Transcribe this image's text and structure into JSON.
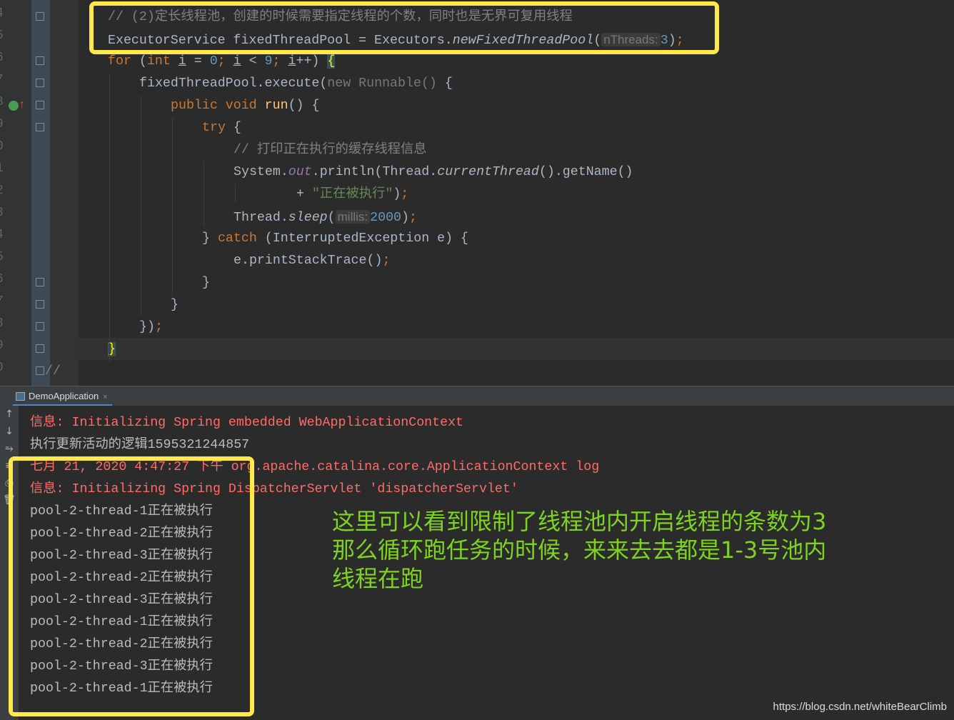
{
  "editor": {
    "line_numbers": [
      "4",
      "5",
      "6",
      "7",
      "8",
      "9",
      "0",
      "1",
      "2",
      "3",
      "4",
      "5",
      "6",
      "7",
      "8",
      "9",
      "0"
    ],
    "lines": [
      {
        "indent": 0,
        "tokens": [
          [
            "// (2)定长线程池，创建的时候需要指定线程的个数，同时也是无界可复用线程",
            "c"
          ]
        ]
      },
      {
        "indent": 0,
        "tokens": [
          [
            "ExecutorService fixedThreadPool = Executors.",
            ""
          ],
          [
            "newFixedThreadPool",
            "i"
          ],
          [
            "(",
            ""
          ],
          [
            "nThreads:",
            "h"
          ],
          [
            "3",
            "n"
          ],
          [
            ")",
            ""
          ],
          [
            ";",
            "k"
          ]
        ]
      },
      {
        "indent": 0,
        "tokens": [
          [
            "for",
            "k"
          ],
          [
            " (",
            ""
          ],
          [
            "int",
            "k"
          ],
          [
            " ",
            ""
          ],
          [
            "i",
            "u"
          ],
          [
            " = ",
            ""
          ],
          [
            "0",
            "n"
          ],
          [
            ";",
            "k"
          ],
          [
            " ",
            ""
          ],
          [
            "i",
            "u"
          ],
          [
            " < ",
            ""
          ],
          [
            "9",
            "n"
          ],
          [
            ";",
            "k"
          ],
          [
            " ",
            ""
          ],
          [
            "i",
            "u"
          ],
          [
            "++) ",
            ""
          ],
          [
            "{",
            "b"
          ]
        ]
      },
      {
        "indent": 1,
        "tokens": [
          [
            "fixedThreadPool.execute(",
            ""
          ],
          [
            "new Runnable()",
            "g"
          ],
          [
            " {",
            ""
          ]
        ]
      },
      {
        "indent": 2,
        "tokens": [
          [
            "public void ",
            "k"
          ],
          [
            "run",
            "fn"
          ],
          [
            "() {",
            ""
          ]
        ]
      },
      {
        "indent": 3,
        "tokens": [
          [
            "try",
            "k"
          ],
          [
            " {",
            ""
          ]
        ]
      },
      {
        "indent": 4,
        "tokens": [
          [
            "// 打印正在执行的缓存线程信息",
            "c"
          ]
        ]
      },
      {
        "indent": 4,
        "tokens": [
          [
            "System.",
            ""
          ],
          [
            "out",
            "f"
          ],
          [
            ".println(Thread.",
            ""
          ],
          [
            "currentThread",
            "i"
          ],
          [
            "().getName()",
            ""
          ]
        ]
      },
      {
        "indent": 6,
        "tokens": [
          [
            "+ ",
            ""
          ],
          [
            "\"正在被执行\"",
            "s"
          ],
          [
            ")",
            ""
          ],
          [
            ";",
            "k"
          ]
        ]
      },
      {
        "indent": 4,
        "tokens": [
          [
            "Thread.",
            ""
          ],
          [
            "sleep",
            "i"
          ],
          [
            "(",
            ""
          ],
          [
            "millis:",
            "h"
          ],
          [
            "2000",
            "n"
          ],
          [
            ")",
            ""
          ],
          [
            ";",
            "k"
          ]
        ]
      },
      {
        "indent": 3,
        "tokens": [
          [
            "} ",
            ""
          ],
          [
            "catch",
            "k"
          ],
          [
            " (InterruptedException e) {",
            ""
          ]
        ]
      },
      {
        "indent": 4,
        "tokens": [
          [
            "e.printStackTrace()",
            ""
          ],
          [
            ";",
            "k"
          ]
        ]
      },
      {
        "indent": 3,
        "tokens": [
          [
            "}",
            ""
          ]
        ]
      },
      {
        "indent": 2,
        "tokens": [
          [
            "}",
            ""
          ]
        ]
      },
      {
        "indent": 1,
        "tokens": [
          [
            "})",
            ""
          ],
          [
            ";",
            "k"
          ]
        ]
      },
      {
        "indent": 0,
        "tokens": [
          [
            "}",
            "b"
          ]
        ]
      },
      {
        "indent": -2,
        "tokens": [
          [
            "//",
            "c"
          ]
        ]
      }
    ]
  },
  "run_tab": {
    "label": "DemoApplication",
    "close": "×"
  },
  "sidebar_icons": [
    "up-arrow-icon",
    "down-arrow-icon",
    "soft-wrap-icon",
    "scroll-to-end-icon",
    "print-icon",
    "trash-icon"
  ],
  "sidebar_glyphs": [
    "↑",
    "↓",
    "⥱",
    "≡",
    "⎙",
    "🗑"
  ],
  "console": {
    "lines": [
      {
        "text": "信息: Initializing Spring embedded WebApplicationContext",
        "red": true
      },
      {
        "text": "执行更新活动的逻辑1595321244857",
        "red": false
      },
      {
        "text": "七月 21, 2020 4:47:27 下午 org.apache.catalina.core.ApplicationContext log",
        "red": true
      },
      {
        "text": "信息: Initializing Spring DispatcherServlet 'dispatcherServlet'",
        "red": true
      },
      {
        "text": "pool-2-thread-1正在被执行",
        "red": false
      },
      {
        "text": "pool-2-thread-2正在被执行",
        "red": false
      },
      {
        "text": "pool-2-thread-3正在被执行",
        "red": false
      },
      {
        "text": "pool-2-thread-2正在被执行",
        "red": false
      },
      {
        "text": "pool-2-thread-3正在被执行",
        "red": false
      },
      {
        "text": "pool-2-thread-1正在被执行",
        "red": false
      },
      {
        "text": "pool-2-thread-2正在被执行",
        "red": false
      },
      {
        "text": "pool-2-thread-3正在被执行",
        "red": false
      },
      {
        "text": "pool-2-thread-1正在被执行",
        "red": false
      }
    ]
  },
  "annotation": {
    "lines": [
      "这里可以看到限制了线程池内开启线程的条数为3",
      "那么循环跑任务的时候，来来去去都是1-3号池内",
      "线程在跑"
    ]
  },
  "watermark": "https://blog.csdn.net/whiteBearClimb",
  "colors": {
    "highlight_box": "#ffe94a",
    "annotation": "#7ed321",
    "error_text": "#ff6b68"
  }
}
